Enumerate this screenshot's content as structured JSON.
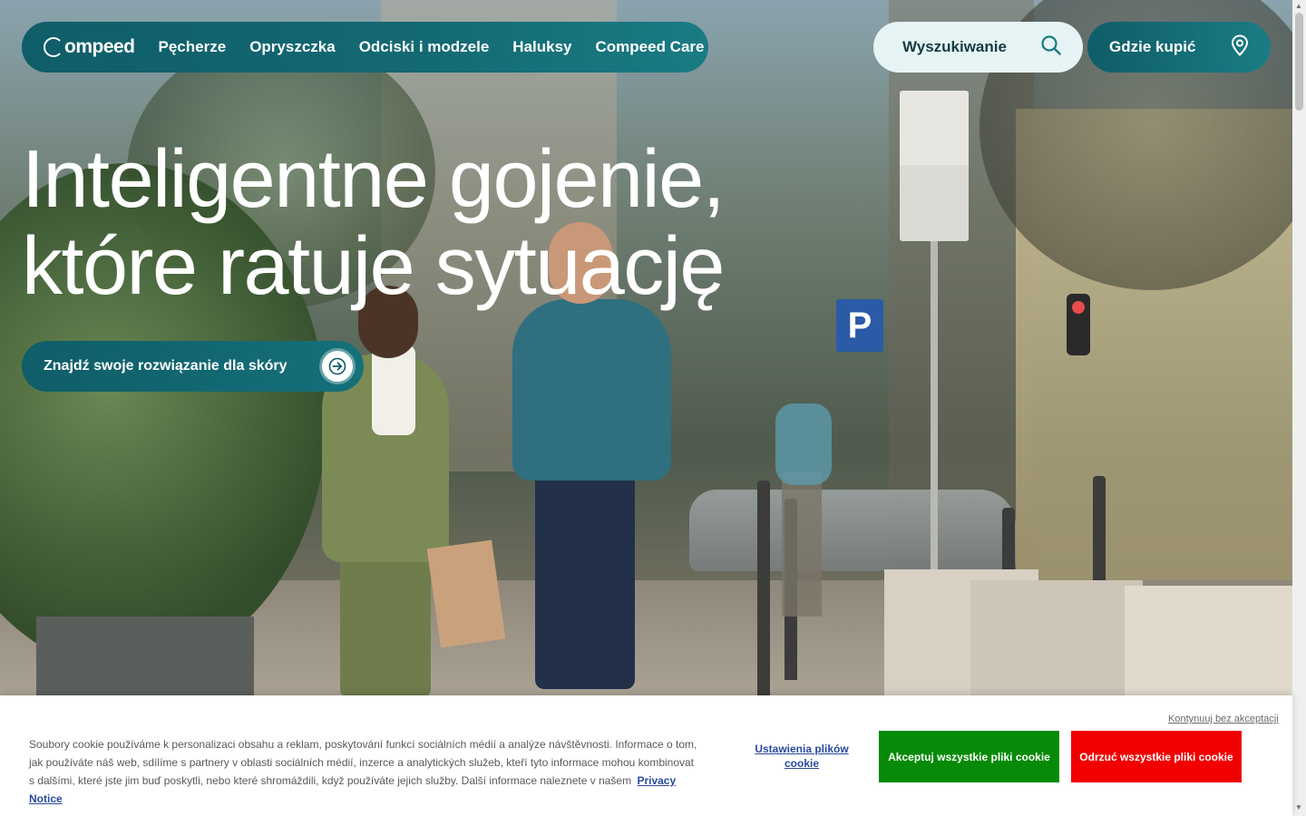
{
  "header": {
    "logo_text": "ompeed",
    "nav": [
      "Pęcherze",
      "Opryszczka",
      "Odciski i modzele",
      "Haluksy",
      "Compeed Care"
    ],
    "search_label": "Wyszukiwanie",
    "search_icon": "search-icon",
    "where_label": "Gdzie kupić",
    "where_icon": "location-pin-icon"
  },
  "hero": {
    "title_line1": "Inteligentne gojenie,",
    "title_line2": "które ratuje sytuację",
    "cta_label": "Znajdź swoje rozwiązanie dla skóry",
    "cta_icon": "arrow-right-icon"
  },
  "cookie": {
    "text": "Soubory cookie používáme k personalizaci obsahu a reklam, poskytování funkcí sociálních médií a analýze návštěvnosti. Informace o tom, jak používáte náš web, sdílíme s partnery v oblasti sociálních médií, inzerce a analytických služeb, kteří tyto informace mohou kombinovat s dalšími, které jste jim buď poskytli, nebo které shromáždili, když používáte jejich služby. Další informace naleznete v našem",
    "privacy_link": "Privacy Notice",
    "continue_link": "Kontynuuj bez akceptacji",
    "settings_label": "Ustawienia plików cookie",
    "accept_label": "Akceptuj wszystkie pliki cookie",
    "reject_label": "Odrzuć wszystkie pliki cookie"
  },
  "colors": {
    "brand_teal": "#0f5d68",
    "search_bg": "#e7f4f5",
    "accept_green": "#078a07",
    "reject_red": "#f20000",
    "link_blue": "#2b4a9f"
  }
}
